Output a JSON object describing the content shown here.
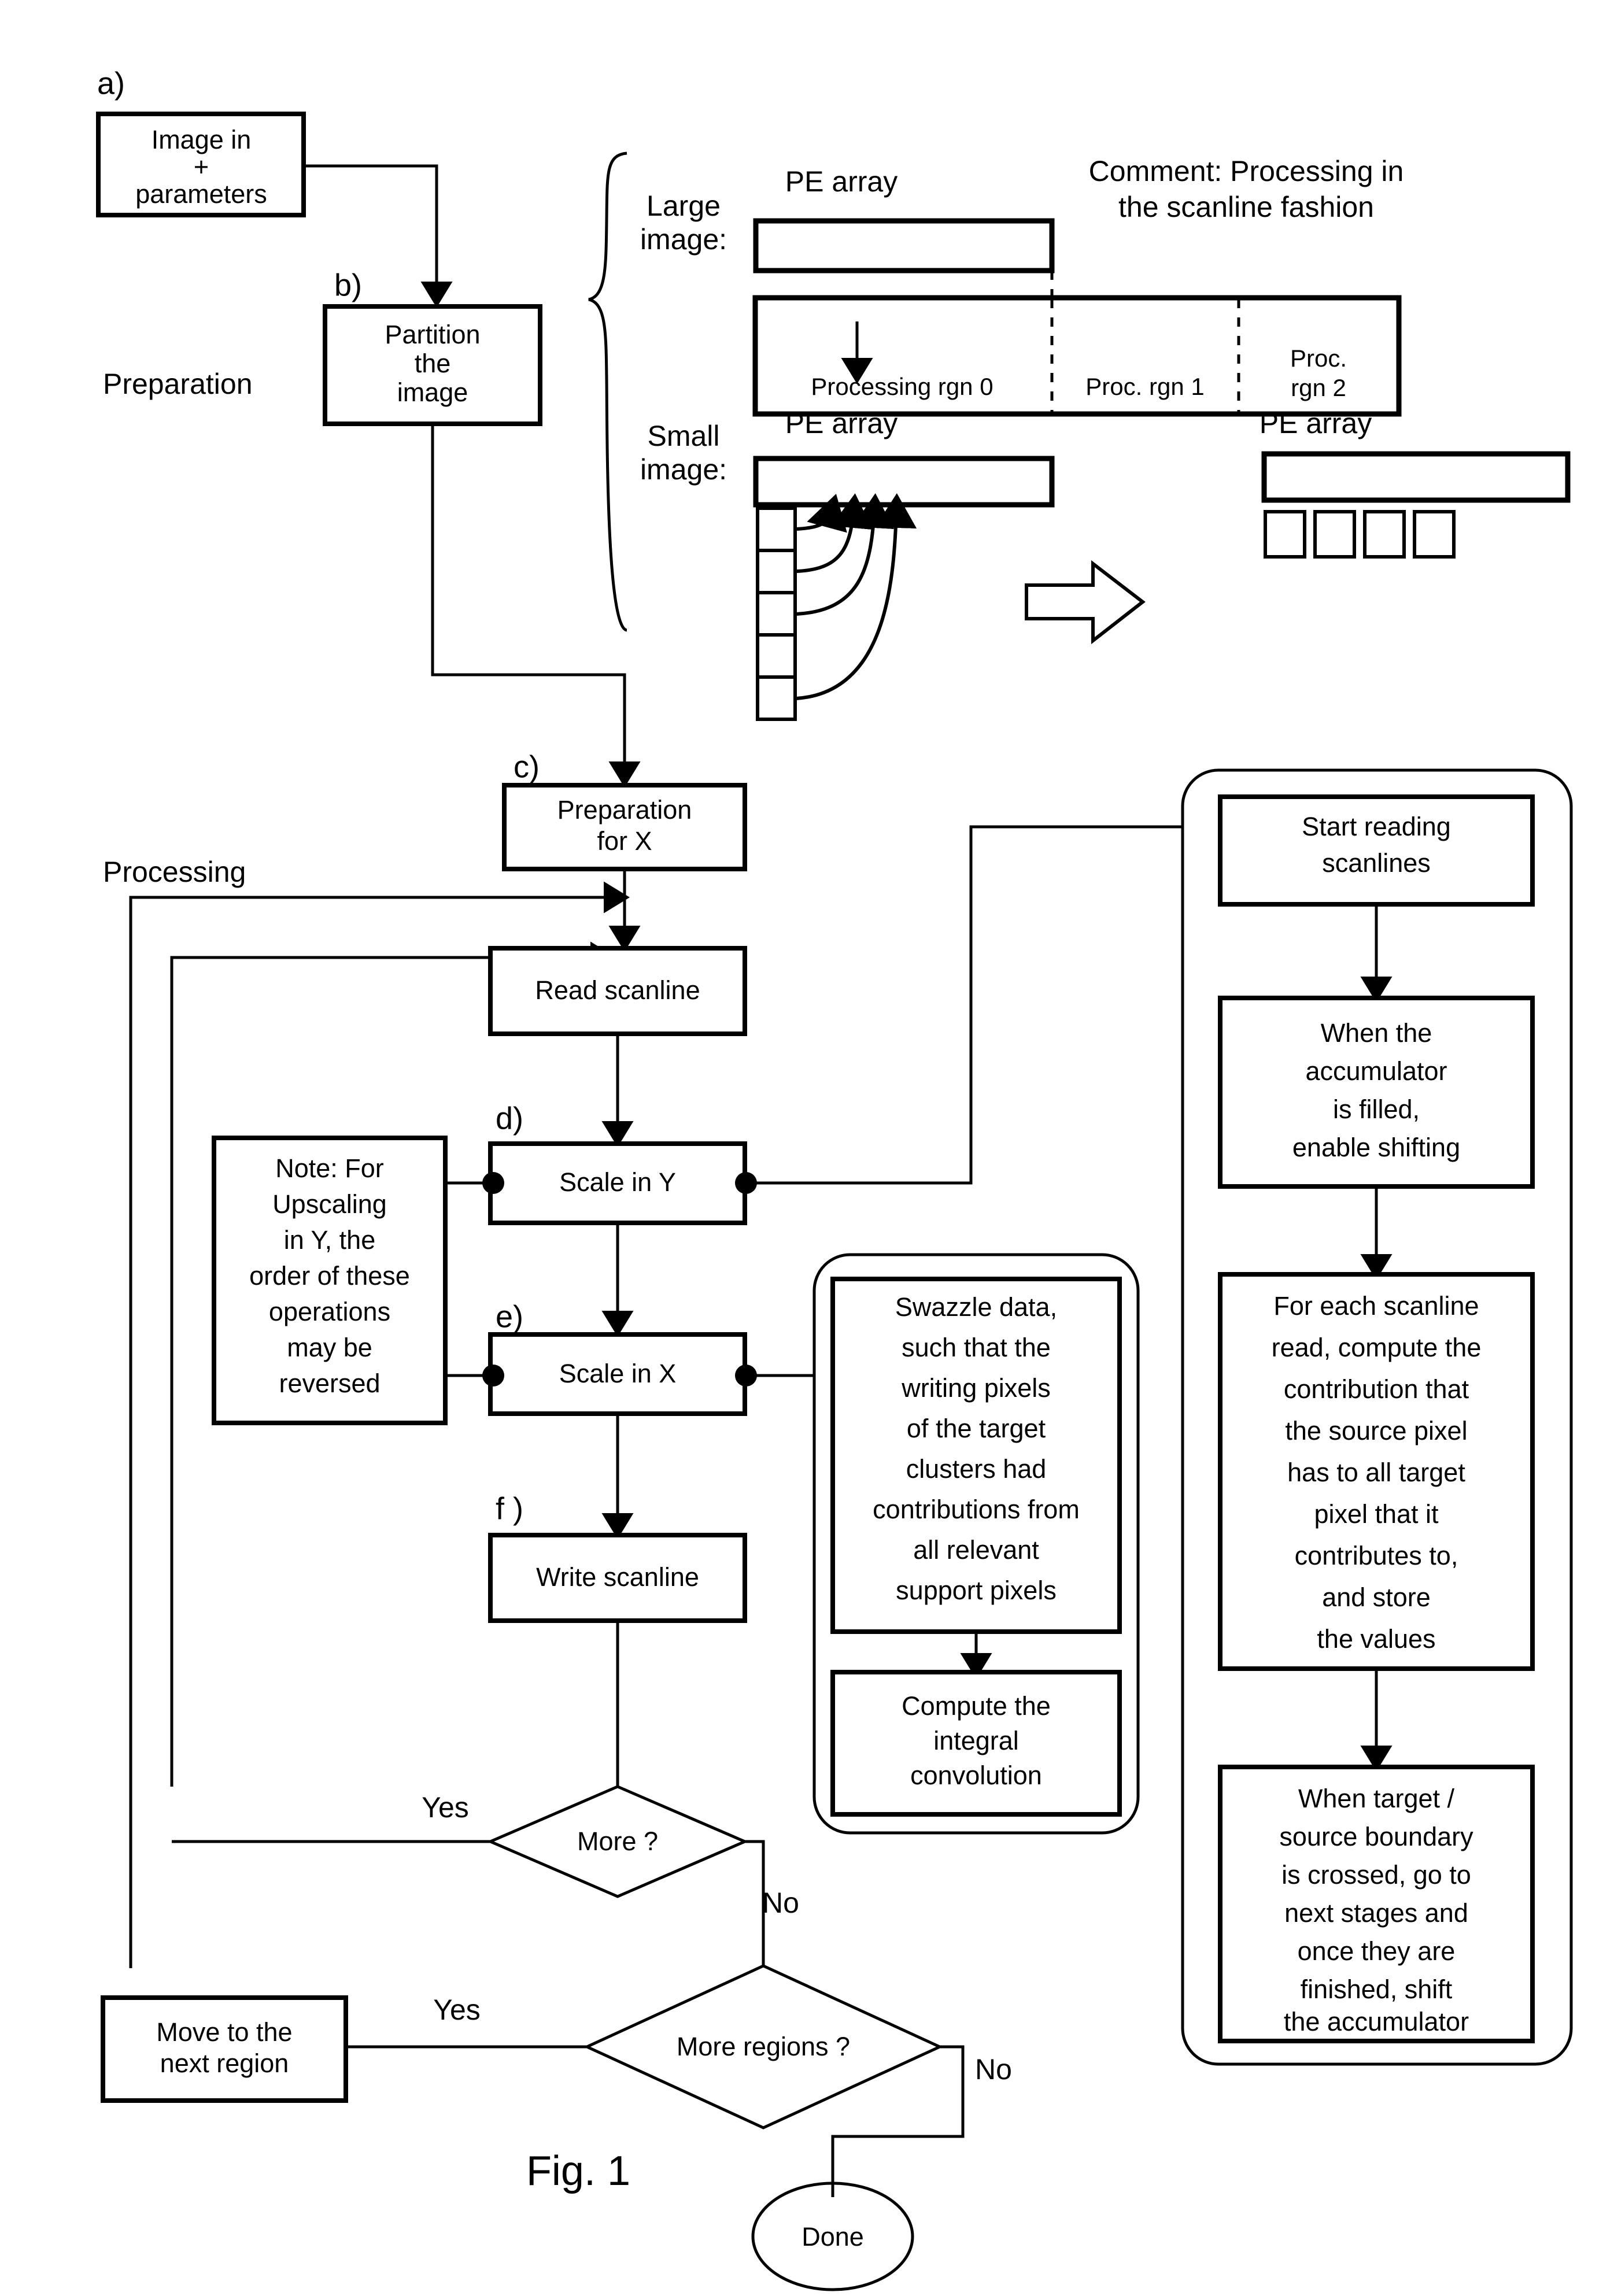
{
  "figure": {
    "caption": "Fig. 1",
    "section_labels": {
      "preparation": "Preparation",
      "processing": "Processing"
    },
    "step_markers": {
      "a": "a)",
      "b": "b)",
      "c": "c)",
      "d": "d)",
      "e": "e)",
      "f": "f )"
    }
  },
  "nodes": {
    "image_in": "Image in\n+\nparameters",
    "image_in_lines": [
      "Image in",
      "+",
      "parameters"
    ],
    "partition": [
      "Partition",
      "the",
      "image"
    ],
    "preparation_for_x": [
      "Preparation",
      "for X"
    ],
    "read_scanline": [
      "Read scanline"
    ],
    "scale_in_y": [
      "Scale in Y"
    ],
    "scale_in_x": [
      "Scale in X"
    ],
    "write_scanline": [
      "Write scanline"
    ],
    "note_upscaling": [
      "Note:  For",
      "Upscaling",
      "in Y, the",
      "order of these",
      "operations",
      "may be",
      "reversed"
    ],
    "swazzle": [
      "Swazzle data,",
      "such that the",
      "writing pixels",
      "of the target",
      "clusters had",
      "contributions from",
      "all relevant",
      "support pixels"
    ],
    "integral_convolution": [
      "Compute the",
      "integral",
      "convolution"
    ],
    "start_reading": [
      "Start reading",
      "scanlines"
    ],
    "accumulator_filled": [
      "When the",
      "accumulator",
      "is filled,",
      "enable shifting"
    ],
    "for_each_scanline": [
      "For each scanline",
      "read, compute the",
      "contribution that",
      "the source pixel",
      "has to all target",
      "pixel that it",
      "contributes to,",
      "and store",
      "the values"
    ],
    "boundary_crossed": [
      "When target /",
      "source boundary",
      "is crossed, go to",
      "next stages and",
      "once they are",
      "finished, shift",
      "the accumulator"
    ],
    "move_next_region": [
      "Move to the",
      "next region"
    ],
    "more_decision": "More ?",
    "more_regions_decision": "More regions ?",
    "done": "Done"
  },
  "edge_labels": {
    "more_yes": "Yes",
    "more_no": "No",
    "more_regions_yes": "Yes",
    "more_regions_no": "No"
  },
  "inset": {
    "comment": [
      "Comment: Processing in",
      "the scanline fashion"
    ],
    "large_image_label": [
      "Large",
      "image:"
    ],
    "small_image_label": [
      "Small",
      "image:"
    ],
    "pe_array_label": "PE array",
    "regions": [
      "Processing rgn 0",
      "Proc. rgn 1",
      "Proc.\nrgn 2"
    ],
    "region_0": "Processing rgn 0",
    "region_1": "Proc. rgn 1",
    "region_2_lines": [
      "Proc.",
      "rgn 2"
    ],
    "small_image_cells": 5,
    "right_pe_cells": 4,
    "curved_arrows": 4
  },
  "colors": {
    "ink": "#000000",
    "paper": "#ffffff"
  }
}
